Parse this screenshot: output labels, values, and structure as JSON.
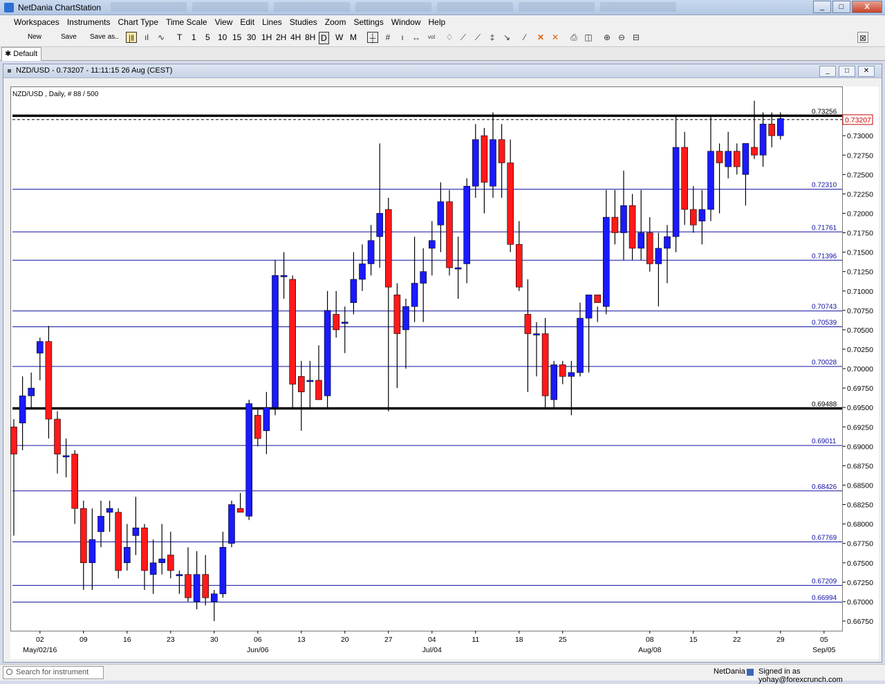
{
  "window": {
    "title": "NetDania ChartStation",
    "min": "_",
    "max": "□",
    "close": "X"
  },
  "menu": [
    "Workspaces",
    "Instruments",
    "Chart Type",
    "Time Scale",
    "View",
    "Edit",
    "Lines",
    "Studies",
    "Zoom",
    "Settings",
    "Window",
    "Help"
  ],
  "toolbar": {
    "new": "New",
    "save": "Save",
    "save_as": "Save as..",
    "timeframes": [
      "T",
      "1",
      "5",
      "10",
      "15",
      "30",
      "1H",
      "2H",
      "4H",
      "8H",
      "D",
      "W",
      "M"
    ],
    "selected_timeframe": "D"
  },
  "tabs": [
    {
      "label": "Default"
    }
  ],
  "chart_window": {
    "header": "NZD/USD - 0.73207 - 11:11:15  26 Aug (CEST)"
  },
  "chart_data": {
    "type": "candlestick",
    "title": "NZD/USD , Daily, # 88 / 500",
    "y_range": [
      0.66625,
      0.73625
    ],
    "y_ticks": [
      "0.66750",
      "0.67000",
      "0.67250",
      "0.67500",
      "0.67750",
      "0.68000",
      "0.68250",
      "0.68500",
      "0.68750",
      "0.69000",
      "0.69250",
      "0.69500",
      "0.69750",
      "0.70000",
      "0.70250",
      "0.70500",
      "0.70750",
      "0.71000",
      "0.71250",
      "0.71500",
      "0.71750",
      "0.72000",
      "0.72250",
      "0.72500",
      "0.72750",
      "0.73000"
    ],
    "x_labels": [
      {
        "label": "02",
        "sub": "May/02/16",
        "i": 3
      },
      {
        "label": "09",
        "i": 8
      },
      {
        "label": "16",
        "i": 13
      },
      {
        "label": "23",
        "i": 18
      },
      {
        "label": "30",
        "i": 23
      },
      {
        "label": "06",
        "sub": "Jun/06",
        "i": 28
      },
      {
        "label": "13",
        "i": 33
      },
      {
        "label": "20",
        "i": 38
      },
      {
        "label": "27",
        "i": 43
      },
      {
        "label": "04",
        "sub": "Jul/04",
        "i": 48
      },
      {
        "label": "11",
        "i": 53
      },
      {
        "label": "18",
        "i": 58
      },
      {
        "label": "25",
        "i": 63
      },
      {
        "label": "08",
        "sub": "Aug/08",
        "i": 73
      },
      {
        "label": "15",
        "i": 78
      },
      {
        "label": "22",
        "i": 83
      },
      {
        "label": "29",
        "i": 88
      },
      {
        "label": "05",
        "sub": "Sep/05",
        "i": 93
      }
    ],
    "candles": [
      [
        0.6925,
        0.6935,
        0.6785,
        0.689
      ],
      [
        0.693,
        0.699,
        0.6895,
        0.6965
      ],
      [
        0.6965,
        0.6995,
        0.695,
        0.6975
      ],
      [
        0.702,
        0.704,
        0.6985,
        0.7035
      ],
      [
        0.7035,
        0.7055,
        0.691,
        0.6935
      ],
      [
        0.6935,
        0.6945,
        0.6865,
        0.689
      ],
      [
        0.6888,
        0.691,
        0.686,
        0.6888
      ],
      [
        0.689,
        0.6895,
        0.68,
        0.682
      ],
      [
        0.682,
        0.683,
        0.6715,
        0.675
      ],
      [
        0.675,
        0.682,
        0.6715,
        0.678
      ],
      [
        0.679,
        0.683,
        0.677,
        0.681
      ],
      [
        0.6815,
        0.683,
        0.679,
        0.682
      ],
      [
        0.6815,
        0.682,
        0.673,
        0.674
      ],
      [
        0.675,
        0.68,
        0.674,
        0.677
      ],
      [
        0.6785,
        0.6835,
        0.676,
        0.6795
      ],
      [
        0.6795,
        0.68,
        0.6715,
        0.674
      ],
      [
        0.6735,
        0.678,
        0.671,
        0.675
      ],
      [
        0.675,
        0.68,
        0.6735,
        0.6755
      ],
      [
        0.676,
        0.679,
        0.673,
        0.674
      ],
      [
        0.6735,
        0.674,
        0.671,
        0.6735
      ],
      [
        0.6735,
        0.677,
        0.67,
        0.6705
      ],
      [
        0.67,
        0.6765,
        0.669,
        0.6735
      ],
      [
        0.6735,
        0.676,
        0.6695,
        0.6705
      ],
      [
        0.67,
        0.6715,
        0.6675,
        0.671
      ],
      [
        0.671,
        0.679,
        0.6705,
        0.677
      ],
      [
        0.6775,
        0.683,
        0.677,
        0.6825
      ],
      [
        0.682,
        0.684,
        0.6815,
        0.6815
      ],
      [
        0.681,
        0.696,
        0.6805,
        0.6955
      ],
      [
        0.694,
        0.695,
        0.69,
        0.691
      ],
      [
        0.692,
        0.697,
        0.689,
        0.695
      ],
      [
        0.695,
        0.714,
        0.694,
        0.712
      ],
      [
        0.712,
        0.715,
        0.709,
        0.712
      ],
      [
        0.7115,
        0.712,
        0.695,
        0.698
      ],
      [
        0.699,
        0.701,
        0.692,
        0.697
      ],
      [
        0.6985,
        0.701,
        0.695,
        0.6985
      ],
      [
        0.6985,
        0.703,
        0.696,
        0.696
      ],
      [
        0.6965,
        0.71,
        0.695,
        0.7075
      ],
      [
        0.707,
        0.71,
        0.704,
        0.705
      ],
      [
        0.706,
        0.708,
        0.702,
        0.706
      ],
      [
        0.7085,
        0.715,
        0.707,
        0.7115
      ],
      [
        0.7115,
        0.716,
        0.71,
        0.7135
      ],
      [
        0.7135,
        0.7185,
        0.712,
        0.7165
      ],
      [
        0.717,
        0.729,
        0.713,
        0.72
      ],
      [
        0.7205,
        0.722,
        0.6945,
        0.7105
      ],
      [
        0.7095,
        0.711,
        0.6975,
        0.7045
      ],
      [
        0.705,
        0.709,
        0.7,
        0.708
      ],
      [
        0.708,
        0.717,
        0.706,
        0.711
      ],
      [
        0.711,
        0.7155,
        0.706,
        0.7125
      ],
      [
        0.7155,
        0.719,
        0.712,
        0.7165
      ],
      [
        0.7185,
        0.724,
        0.715,
        0.7215
      ],
      [
        0.7215,
        0.723,
        0.712,
        0.713
      ],
      [
        0.713,
        0.717,
        0.709,
        0.713
      ],
      [
        0.7135,
        0.7245,
        0.711,
        0.7235
      ],
      [
        0.7235,
        0.7315,
        0.722,
        0.7295
      ],
      [
        0.73,
        0.731,
        0.72,
        0.724
      ],
      [
        0.7235,
        0.733,
        0.722,
        0.7295
      ],
      [
        0.7295,
        0.7315,
        0.722,
        0.7265
      ],
      [
        0.7265,
        0.7295,
        0.715,
        0.716
      ],
      [
        0.716,
        0.719,
        0.71,
        0.7105
      ],
      [
        0.707,
        0.7115,
        0.697,
        0.7045
      ],
      [
        0.7045,
        0.706,
        0.699,
        0.7045
      ],
      [
        0.7045,
        0.7065,
        0.695,
        0.6965
      ],
      [
        0.696,
        0.701,
        0.695,
        0.7005
      ],
      [
        0.7005,
        0.701,
        0.698,
        0.699
      ],
      [
        0.699,
        0.701,
        0.694,
        0.6995
      ],
      [
        0.6995,
        0.7085,
        0.699,
        0.7065
      ],
      [
        0.7065,
        0.7095,
        0.6995,
        0.7095
      ],
      [
        0.7095,
        0.708,
        0.706,
        0.7085
      ],
      [
        0.708,
        0.723,
        0.707,
        0.7195
      ],
      [
        0.7195,
        0.723,
        0.716,
        0.7175
      ],
      [
        0.7175,
        0.7255,
        0.714,
        0.721
      ],
      [
        0.721,
        0.7225,
        0.714,
        0.7155
      ],
      [
        0.7155,
        0.723,
        0.714,
        0.7175
      ],
      [
        0.7175,
        0.7195,
        0.7125,
        0.7135
      ],
      [
        0.7135,
        0.7175,
        0.708,
        0.7155
      ],
      [
        0.7155,
        0.7185,
        0.711,
        0.717
      ],
      [
        0.717,
        0.7325,
        0.715,
        0.7285
      ],
      [
        0.7285,
        0.7305,
        0.7185,
        0.7205
      ],
      [
        0.7205,
        0.7235,
        0.7175,
        0.7185
      ],
      [
        0.719,
        0.723,
        0.716,
        0.7205
      ],
      [
        0.7205,
        0.7325,
        0.719,
        0.728
      ],
      [
        0.728,
        0.729,
        0.72,
        0.7265
      ],
      [
        0.726,
        0.7305,
        0.7245,
        0.728
      ],
      [
        0.728,
        0.729,
        0.725,
        0.726
      ],
      [
        0.725,
        0.729,
        0.721,
        0.729
      ],
      [
        0.7285,
        0.7345,
        0.727,
        0.7275
      ],
      [
        0.7275,
        0.733,
        0.726,
        0.7315
      ],
      [
        0.7315,
        0.733,
        0.7285,
        0.73
      ],
      [
        0.73,
        0.733,
        0.7295,
        0.7322
      ]
    ],
    "h_lines": [
      {
        "value": 0.73256,
        "label": "0.73256",
        "bold": true
      },
      {
        "value": 0.7231,
        "label": "0.72310"
      },
      {
        "value": 0.71761,
        "label": "0.71761"
      },
      {
        "value": 0.71396,
        "label": "0.71396"
      },
      {
        "value": 0.70743,
        "label": "0.70743"
      },
      {
        "value": 0.70539,
        "label": "0.70539"
      },
      {
        "value": 0.70028,
        "label": "0.70028"
      },
      {
        "value": 0.69488,
        "label": "0.69488",
        "bold": true
      },
      {
        "value": 0.69011,
        "label": "0.69011"
      },
      {
        "value": 0.68426,
        "label": "0.68426"
      },
      {
        "value": 0.67769,
        "label": "0.67769"
      },
      {
        "value": 0.67209,
        "label": "0.67209"
      },
      {
        "value": 0.66994,
        "label": "0.66994"
      }
    ],
    "current_price": {
      "value": 0.73207,
      "label": "0.73207"
    },
    "colors": {
      "up": "#1a1aff",
      "down": "#ff1a1a",
      "line": "#1010a0",
      "bold": "#000000",
      "price": "#cc0000"
    }
  },
  "status": {
    "search_placeholder": "Search for instrument",
    "provider": "NetDania",
    "signed_in": "Signed in as yohay@forexcrunch.com"
  }
}
